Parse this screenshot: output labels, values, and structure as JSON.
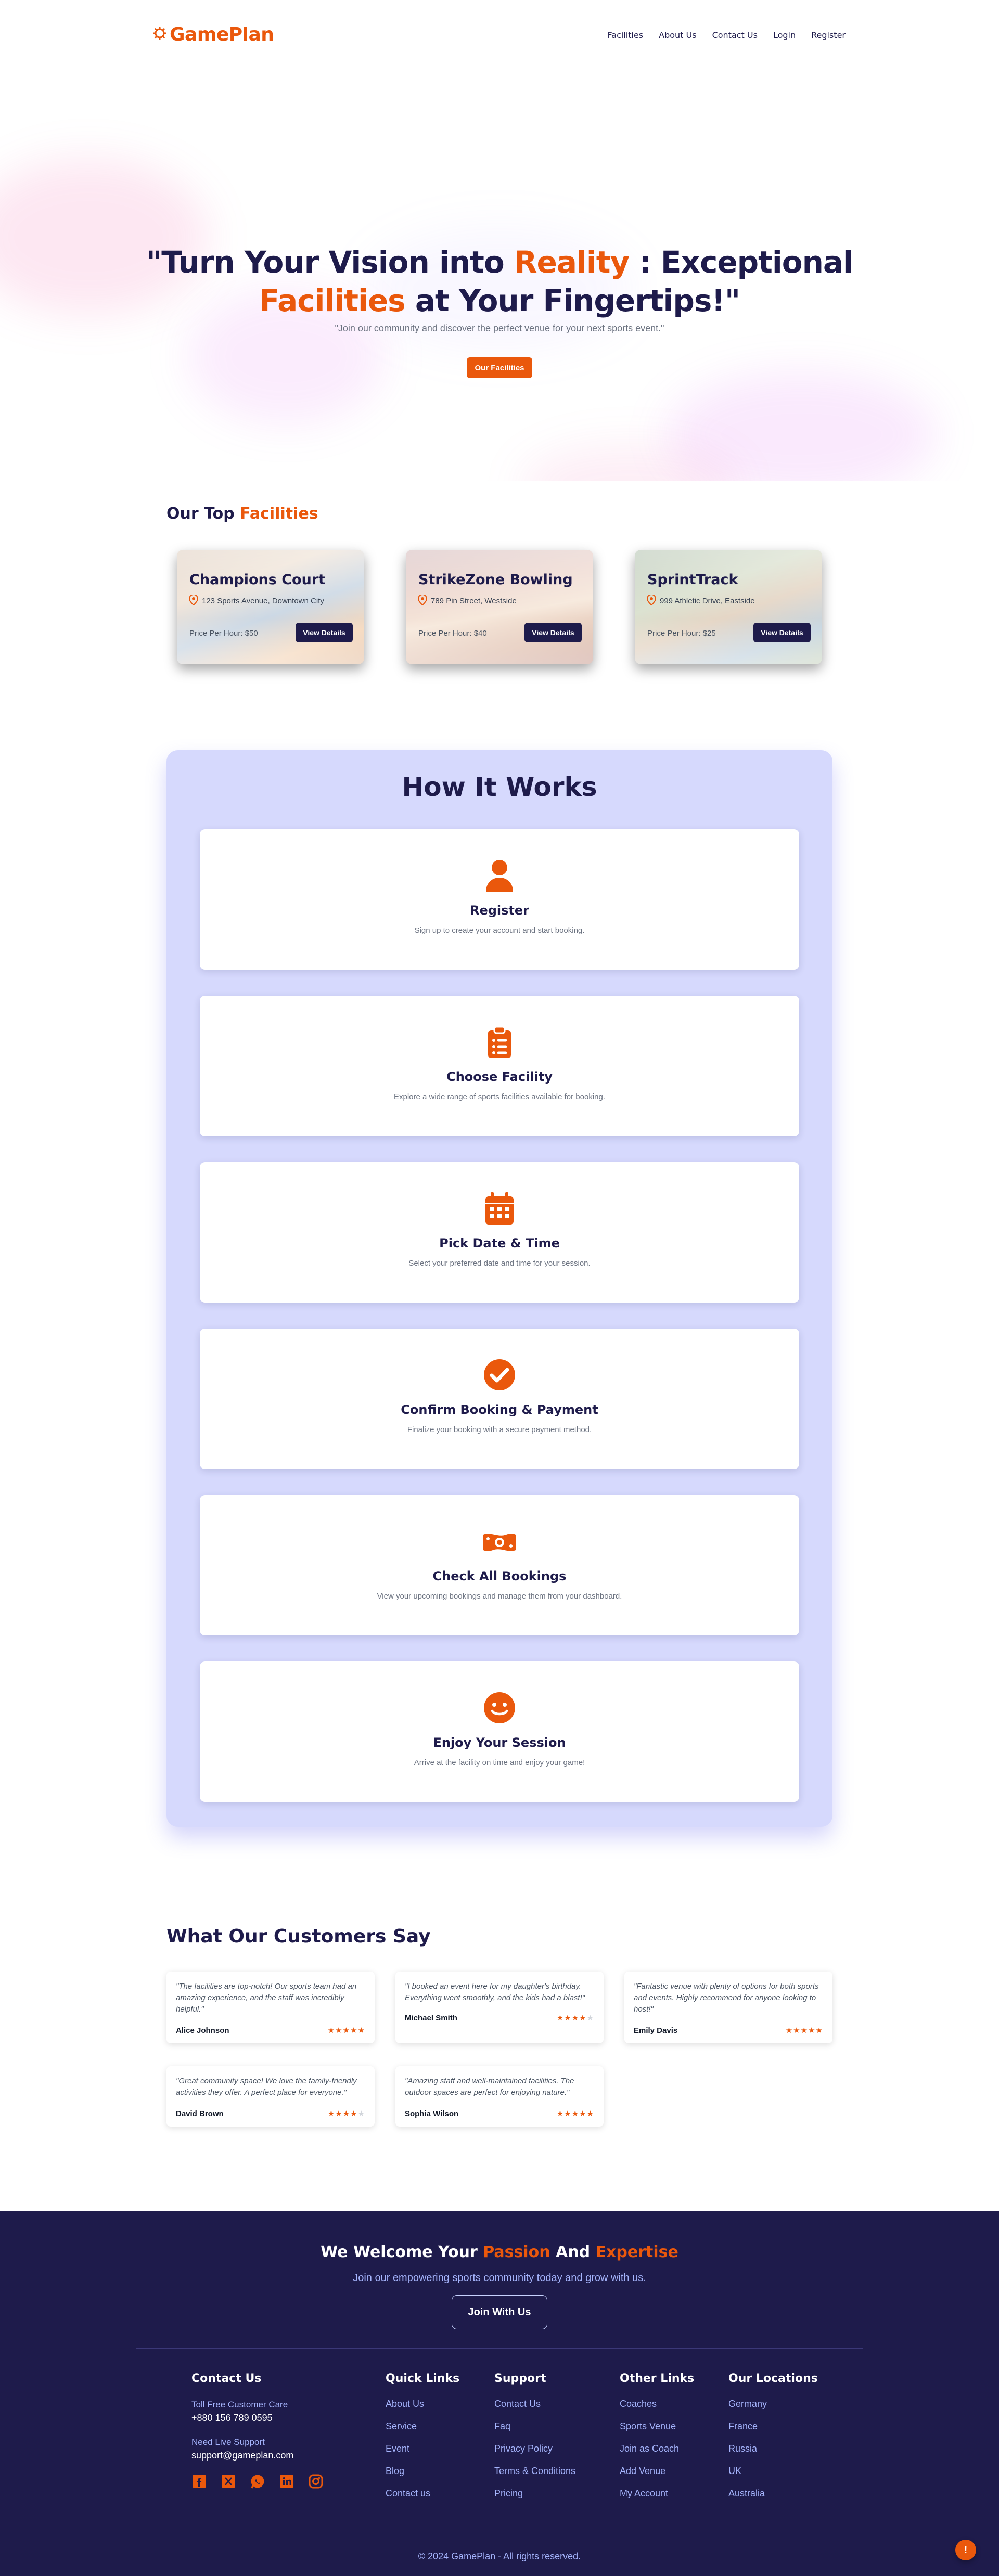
{
  "header": {
    "logo_text": "GamePlan",
    "nav": [
      "Facilities",
      "About Us",
      "Contact Us",
      "Login",
      "Register"
    ]
  },
  "hero": {
    "title_part1": "\"Turn Your Vision into ",
    "title_highlight1": "Reality",
    "title_part2": " : Exceptional",
    "title_highlight2": "Facilities",
    "title_part3": " at Your Fingertips!\"",
    "subtitle": "\"Join our community and discover the perfect venue for your next sports event.\"",
    "cta": "Our Facilities"
  },
  "facilities": {
    "title_plain": "Our Top ",
    "title_highlight": "Facilities",
    "items": [
      {
        "name": "Champions Court",
        "address": "123 Sports Avenue, Downtown City",
        "price": "Price Per Hour: $50",
        "button": "View Details"
      },
      {
        "name": "StrikeZone Bowling",
        "address": "789 Pin Street, Westside",
        "price": "Price Per Hour: $40",
        "button": "View Details"
      },
      {
        "name": "SprintTrack",
        "address": "999 Athletic Drive, Eastside",
        "price": "Price Per Hour: $25",
        "button": "View Details"
      }
    ]
  },
  "how_it_works": {
    "title": "How It Works",
    "steps": [
      {
        "icon": "user-icon",
        "title": "Register",
        "desc": "Sign up to create your account and start booking."
      },
      {
        "icon": "clipboard-icon",
        "title": "Choose Facility",
        "desc": "Explore a wide range of sports facilities available for booking."
      },
      {
        "icon": "calendar-icon",
        "title": "Pick Date & Time",
        "desc": "Select your preferred date and time for your session."
      },
      {
        "icon": "check-circle-icon",
        "title": "Confirm Booking & Payment",
        "desc": "Finalize your booking with a secure payment method."
      },
      {
        "icon": "money-icon",
        "title": "Check All Bookings",
        "desc": "View your upcoming bookings and manage them from your dashboard."
      },
      {
        "icon": "smile-icon",
        "title": "Enjoy Your Session",
        "desc": "Arrive at the facility on time and enjoy your game!"
      }
    ]
  },
  "testimonials": {
    "title": "What Our Customers Say",
    "items": [
      {
        "quote": "\"The facilities are top-notch! Our sports team had an amazing experience, and the staff was incredibly helpful.\"",
        "name": "Alice Johnson",
        "rating": 5
      },
      {
        "quote": "\"I booked an event here for my daughter's birthday. Everything went smoothly, and the kids had a blast!\"",
        "name": "Michael Smith",
        "rating": 4
      },
      {
        "quote": "\"Fantastic venue with plenty of options for both sports and events. Highly recommend for anyone looking to host!\"",
        "name": "Emily Davis",
        "rating": 5
      },
      {
        "quote": "\"Great community space! We love the family-friendly activities they offer. A perfect place for everyone.\"",
        "name": "David Brown",
        "rating": 4
      },
      {
        "quote": "\"Amazing staff and well-maintained facilities. The outdoor spaces are perfect for enjoying nature.\"",
        "name": "Sophia Wilson",
        "rating": 5
      }
    ]
  },
  "footer": {
    "welcome_part1": "We Welcome Your ",
    "welcome_highlight1": "Passion",
    "welcome_part2": " And ",
    "welcome_highlight2": "Expertise",
    "welcome_sub": "Join our empowering sports community today and grow with us.",
    "join_button": "Join With Us",
    "contact": {
      "title": "Contact Us",
      "phone_label": "Toll Free Customer Care",
      "phone": "+880 156 789 0595",
      "support_label": "Need Live Support",
      "email": "support@gameplan.com"
    },
    "socials": [
      "facebook-icon",
      "x-icon",
      "whatsapp-icon",
      "linkedin-icon",
      "instagram-icon"
    ],
    "columns": [
      {
        "title": "Quick Links",
        "links": [
          "About Us",
          "Service",
          "Event",
          "Blog",
          "Contact us"
        ]
      },
      {
        "title": "Support",
        "links": [
          "Contact Us",
          "Faq",
          "Privacy Policy",
          "Terms & Conditions",
          "Pricing"
        ]
      },
      {
        "title": "Other Links",
        "links": [
          "Coaches",
          "Sports Venue",
          "Join as Coach",
          "Add Venue",
          "My Account"
        ]
      },
      {
        "title": "Our Locations",
        "links": [
          "Germany",
          "France",
          "Russia",
          "UK",
          "Australia"
        ]
      }
    ],
    "copyright": "© 2024 GamePlan - All rights reserved.",
    "fab_label": "!"
  },
  "colors": {
    "accent": "#ea580c",
    "navy": "#1e1b4b",
    "how_bg": "#d6d9fd"
  }
}
